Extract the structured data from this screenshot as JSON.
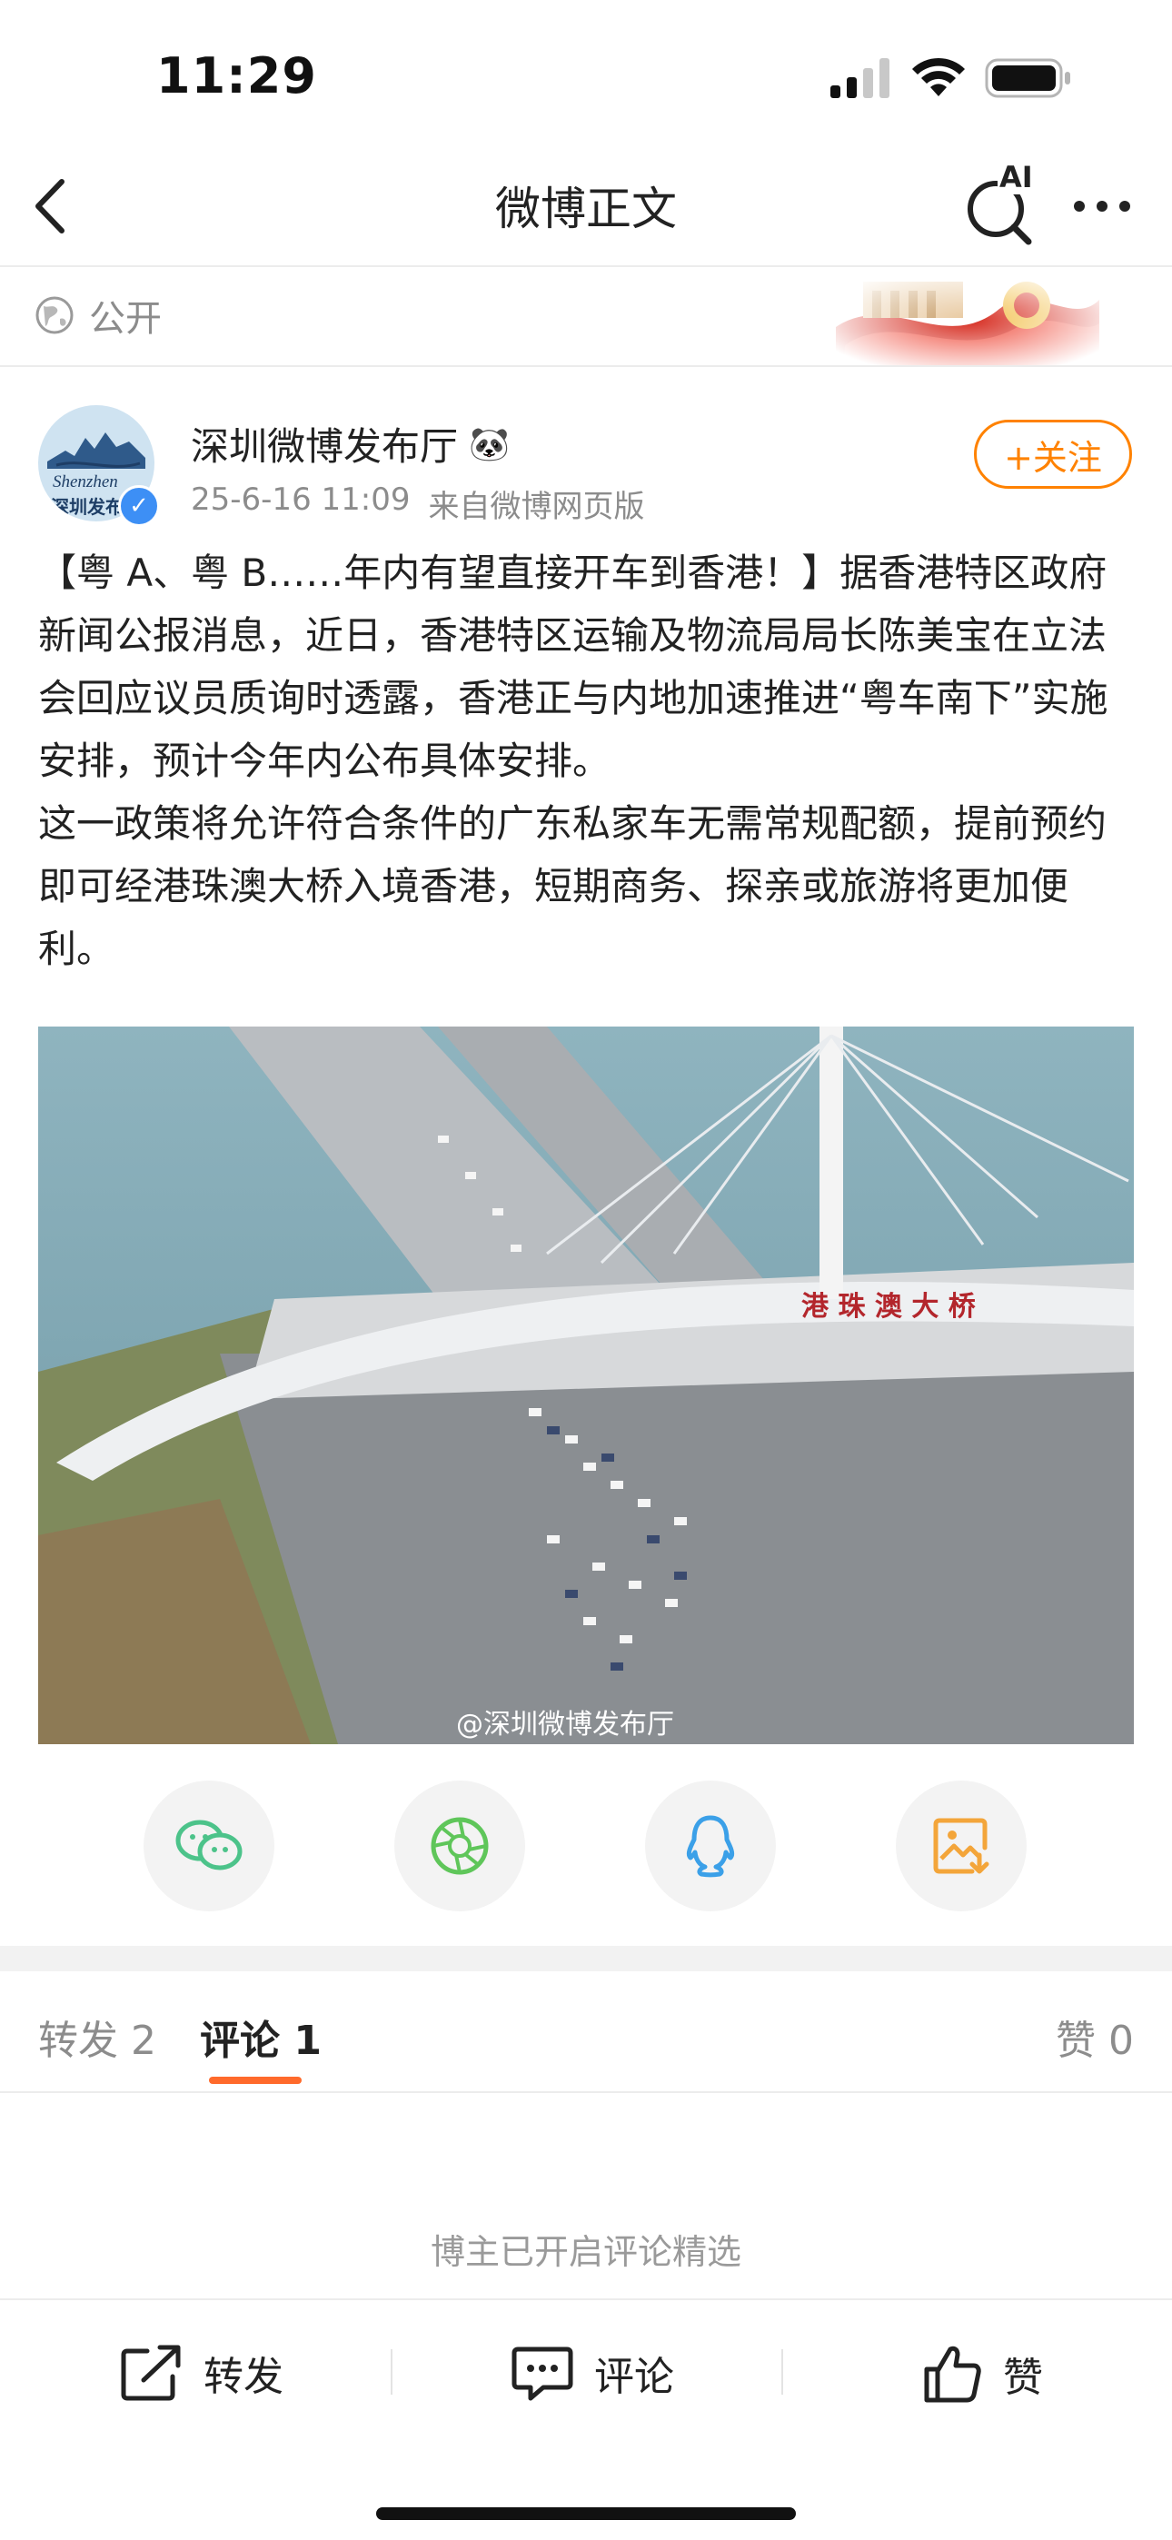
{
  "status_bar": {
    "time": "11:29"
  },
  "nav": {
    "title": "微博正文",
    "ai_label": "AI"
  },
  "visibility": {
    "label": "公开"
  },
  "author": {
    "name": "深圳微博发布厅",
    "name_emoji": "🐼",
    "avatar_text_en": "Shenzhen",
    "avatar_text_cn": "深圳发布",
    "date": "25-6-16 11:09",
    "source": "来自微博网页版",
    "follow_label": "+关注"
  },
  "post": {
    "paragraph1": "【粤 A、粤 B……年内有望直接开车到香港！】据香港特区政府新闻公报消息，近日，香港特区运输及物流局局长陈美宝在立法会回应议员质询时透露，香港正与内地加速推进“粤车南下”实施安排，预计今年内公布具体安排。",
    "paragraph2": "这一政策将允许符合条件的广东私家车无需常规配额，提前预约即可经港珠澳大桥入境香港，短期商务、探亲或旅游将更加便利。",
    "image_sign": "港 珠 澳 大 桥",
    "image_watermark": "@深圳微博发布厅"
  },
  "share_icons": [
    "wechat-icon",
    "moments-icon",
    "qq-icon",
    "save-image-icon"
  ],
  "tabs": {
    "repost": "转发 2",
    "comment": "评论 1",
    "like": "赞 0"
  },
  "comment_notice": "博主已开启评论精选",
  "bottom_actions": {
    "repost": "转发",
    "comment": "评论",
    "like": "赞"
  },
  "colors": {
    "accent": "#ff8200",
    "tab_underline": "#ff6a2b",
    "verified": "#3d8ff5",
    "wechat": "#4cc38a",
    "moments": "#5fc65a",
    "qq": "#3ba0e8",
    "save": "#f3a53a"
  }
}
